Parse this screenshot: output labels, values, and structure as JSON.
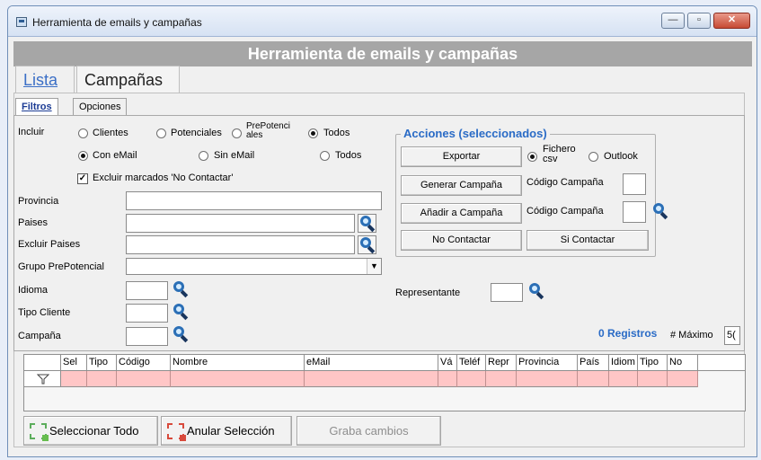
{
  "window": {
    "title": "Herramienta de emails y campañas",
    "controls": {
      "minimize": "—",
      "maximize": "▫",
      "close": "✕"
    }
  },
  "header": {
    "title": "Herramienta de emails y campañas"
  },
  "main_tabs": [
    {
      "label": "Lista",
      "active": true
    },
    {
      "label": "Campañas",
      "active": false
    }
  ],
  "sub_tabs": [
    {
      "label": "Filtros",
      "active": true
    },
    {
      "label": "Opciones",
      "active": false
    }
  ],
  "filters": {
    "incluir_label": "Incluir",
    "incluir_options": [
      "Clientes",
      "Potenciales",
      "PrePotenci ales",
      "Todos"
    ],
    "incluir_selected": "Todos",
    "email_options": [
      "Con eMail",
      "Sin eMail",
      "Todos"
    ],
    "email_selected": "Con eMail",
    "excluir_no_contactar": {
      "label": "Excluir marcados 'No Contactar'",
      "checked": true
    },
    "provincia_label": "Provincia",
    "paises_label": "Paises",
    "excluir_paises_label": "Excluir Paises",
    "grupo_label": "Grupo PrePotencial",
    "idioma_label": "Idioma",
    "tipo_cliente_label": "Tipo Cliente",
    "campana_label": "Campaña",
    "representante_label": "Representante"
  },
  "acciones": {
    "title": "Acciones (seleccionados)",
    "exportar": "Exportar",
    "fichero_csv": "Fichero csv",
    "outlook": "Outlook",
    "export_selected": "Fichero csv",
    "generar_campana": "Generar Campaña",
    "anadir_campana": "Añadir a Campaña",
    "codigo_campana_1": "Código Campaña",
    "codigo_campana_2": "Código Campaña",
    "no_contactar": "No Contactar",
    "si_contactar": "Si Contactar"
  },
  "stats": {
    "registros": "0 Registros",
    "maximo_label": "# Máximo",
    "maximo_value": "5("
  },
  "grid": {
    "columns": [
      "Sel",
      "Tipo",
      "Código",
      "Nombre",
      "eMail",
      "Vá",
      "Teléf",
      "Repr",
      "Provincia",
      "País",
      "Idiom",
      "Tipo",
      "No"
    ]
  },
  "bottom_buttons": {
    "select_all": "Seleccionar Todo",
    "cancel_selection": "Anular Selección",
    "save_changes": "Graba cambios"
  },
  "icons": {
    "app": "app-icon",
    "search": "magnifier-icon",
    "filter": "funnel-icon",
    "select_all": "select-all-icon",
    "deselect": "deselect-icon"
  },
  "colors": {
    "header_bg": "#a6a6a6",
    "accent": "#2a6bc6",
    "pink_row": "#ffc6c6"
  }
}
